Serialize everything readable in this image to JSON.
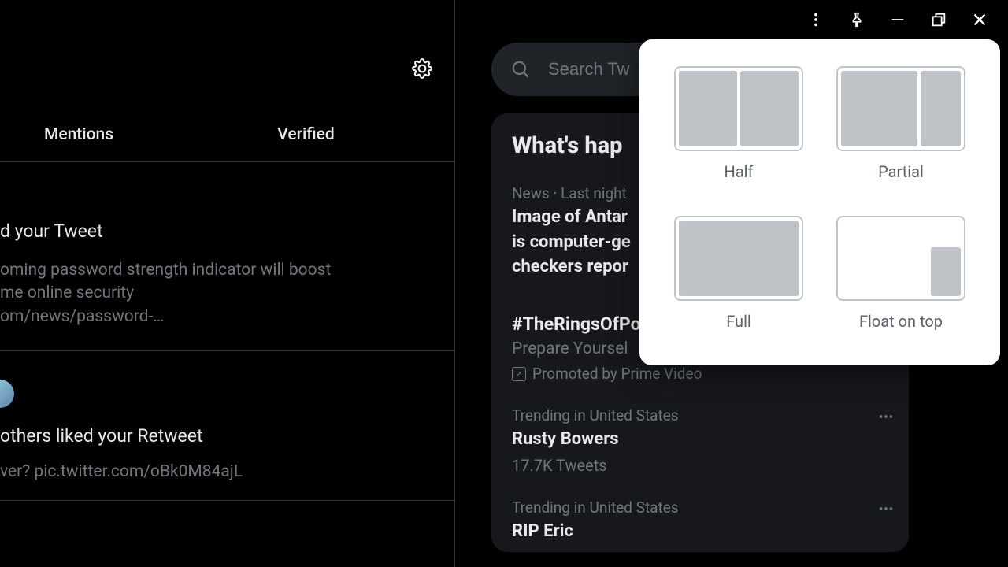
{
  "titlebar": {
    "more": "more-icon",
    "pin": "pin-icon",
    "min": "minimize-icon",
    "restore": "restore-icon",
    "close": "close-icon"
  },
  "left": {
    "settings_icon": "settings-icon",
    "tabs": {
      "mentions": "Mentions",
      "verified": "Verified"
    },
    "notif1": {
      "title": "d your Tweet",
      "line1": "oming password strength indicator will boost",
      "line2": "me online security",
      "line3": "om/news/password-…"
    },
    "notif2": {
      "title": "others liked your Retweet",
      "line1": "ver? pic.twitter.com/oBk0M84ajL"
    }
  },
  "search": {
    "placeholder": "Search Tw"
  },
  "whats": {
    "title": "What's hap",
    "items": [
      {
        "meta": "News · Last night",
        "headline_l1": "Image of Antar",
        "headline_l2": "is computer-ge",
        "headline_l3": "checkers repor"
      },
      {
        "hashtag": "#TheRingsOfPo",
        "sub": "Prepare Yoursel",
        "promo": "Promoted by Prime Video"
      },
      {
        "meta": "Trending in United States",
        "headline": "Rusty Bowers",
        "sub": "17.7K Tweets"
      },
      {
        "meta": "Trending in United States",
        "headline": "RIP Eric"
      }
    ]
  },
  "popover": {
    "half": "Half",
    "partial": "Partial",
    "full": "Full",
    "float": "Float on top"
  }
}
